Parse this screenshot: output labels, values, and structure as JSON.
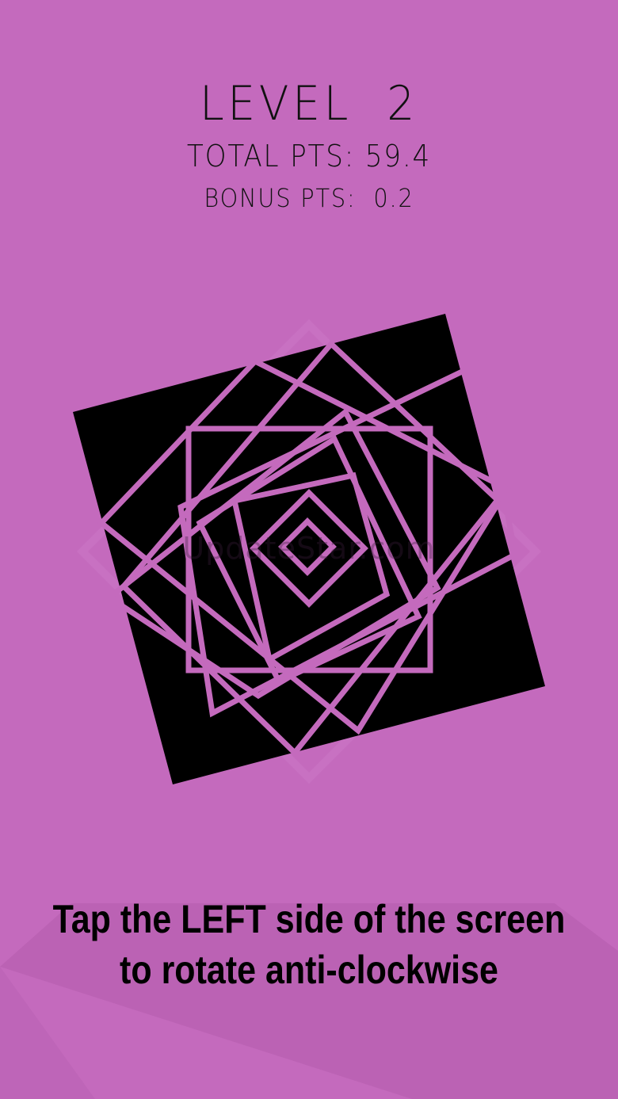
{
  "hud": {
    "level_label": "LEVEL",
    "level_value": "2",
    "total_label": "TOTAL PTS:",
    "total_value": "59.4",
    "bonus_label": "BONUS PTS:",
    "bonus_value": "0.2"
  },
  "watermark": "UpdateStar.com",
  "instructions": {
    "line1": "Tap the LEFT side of the screen",
    "line2": "to rotate anti-clockwise"
  },
  "colors": {
    "background": "#c46abd",
    "shape_fill": "#000000",
    "line_color": "#c46abd",
    "text": "#111111"
  }
}
